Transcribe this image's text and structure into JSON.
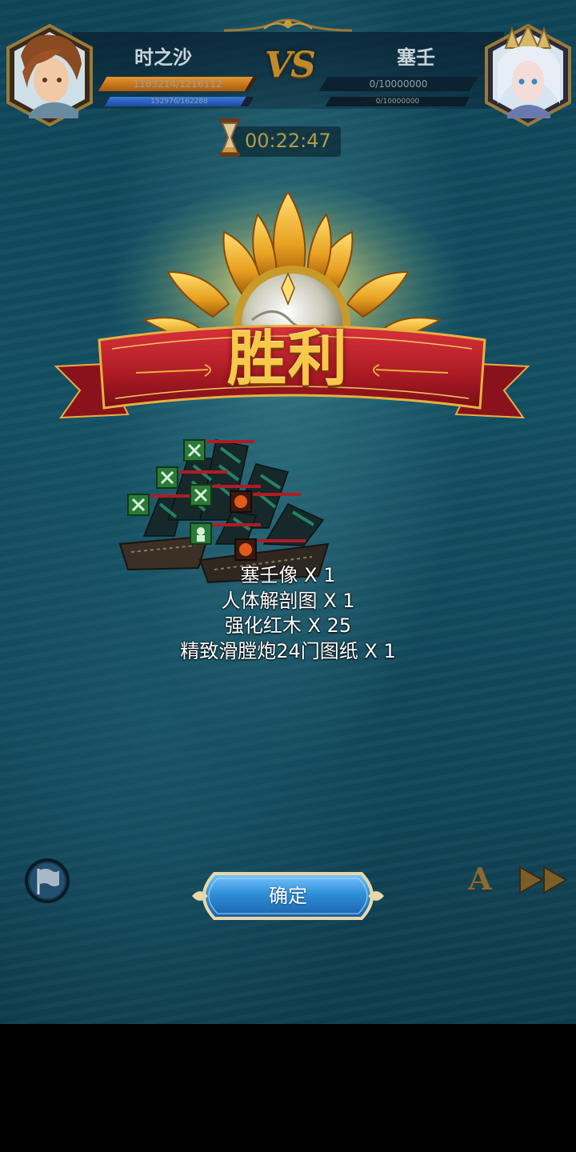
{
  "header": {
    "player": {
      "name": "时之沙",
      "hp_text": "1183214/1216112",
      "hp_fraction": 0.973,
      "sub_text": "152976/162288",
      "sub_fraction": 0.943,
      "portrait": "male-captain-portrait"
    },
    "vs_label": "VS",
    "enemy": {
      "name": "塞壬",
      "hp_text": "0/10000000",
      "hp_fraction": 0,
      "sub_text": "0/10000000",
      "sub_fraction": 0,
      "portrait": "siren-portrait"
    }
  },
  "timer": {
    "icon": "hourglass-icon",
    "value": "00:22:47"
  },
  "result": {
    "title": "胜利",
    "emblem": "sun-banner-emblem"
  },
  "rewards": [
    "塞壬像 X 1",
    "人体解剖图 X 1",
    "强化红木 X 25",
    "精致滑膛炮24门图纸 X 1"
  ],
  "controls": {
    "confirm_label": "确定",
    "auto_label": "A",
    "flag_icon": "surrender-flag-icon",
    "speed_icon": "fast-forward-icon"
  },
  "colors": {
    "gold": "#f6c94a",
    "banner_red": "#b8202a",
    "button_blue": "#2f8fd8",
    "hp_orange": "#c8781c",
    "sub_blue": "#2a62b8"
  }
}
